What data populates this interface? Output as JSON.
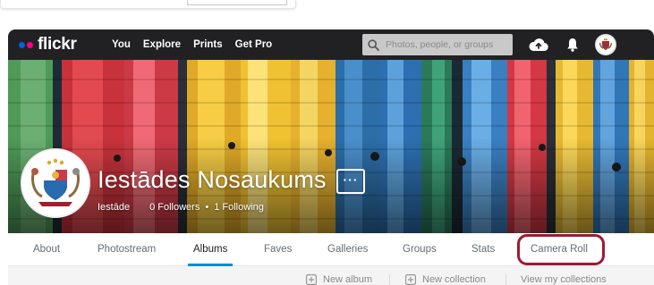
{
  "nav": {
    "logo": "flickr",
    "links": [
      "You",
      "Explore",
      "Prints",
      "Get Pro"
    ],
    "search_placeholder": "Photos, people, or groups",
    "icons": [
      "upload-cloud-icon",
      "bell-icon",
      "avatar"
    ]
  },
  "profile": {
    "name": "Iestādes Nosaukums",
    "username": "Iestāde",
    "followers": "0 Followers",
    "separator": "•",
    "following": "1 Following",
    "more_label": "···"
  },
  "tabs": [
    "About",
    "Photostream",
    "Albums",
    "Faves",
    "Galleries",
    "Groups",
    "Stats",
    "Camera Roll"
  ],
  "active_tab": "Albums",
  "highlighted_tab": "Camera Roll",
  "toolbar": {
    "new_album": "New album",
    "new_collection": "New collection",
    "view_collections": "View my collections"
  },
  "colors": {
    "nav_bg": "#212124",
    "flickr_blue": "#0063dc",
    "flickr_pink": "#ff0084",
    "active_underline": "#008ecf",
    "highlight_outline": "#a11932"
  }
}
